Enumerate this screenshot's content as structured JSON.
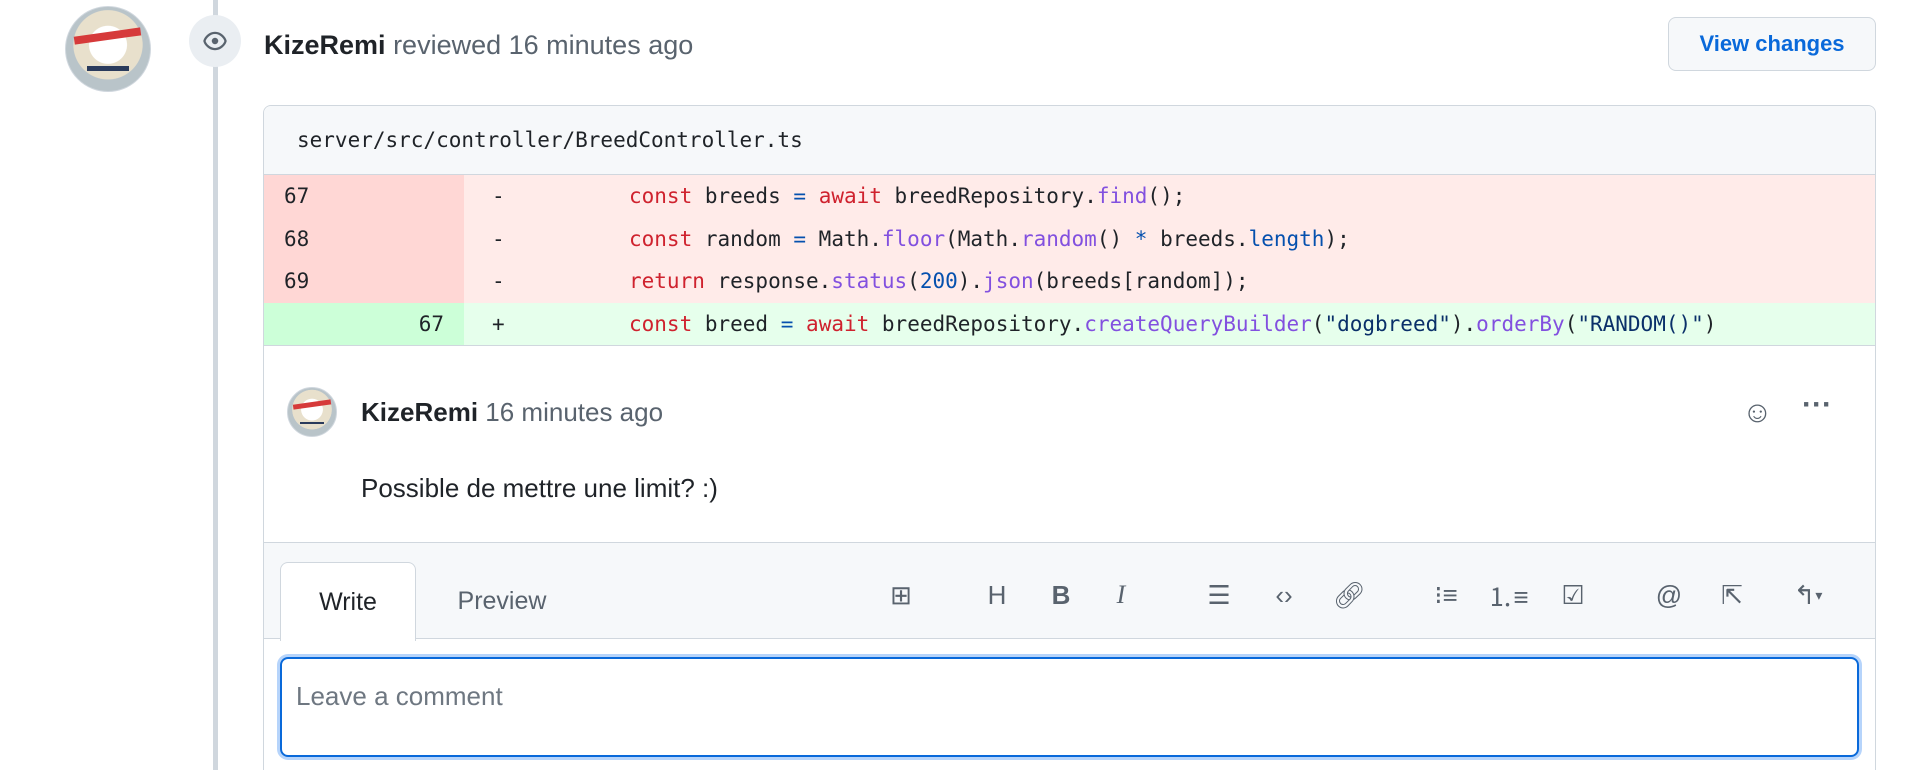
{
  "review": {
    "author": "KizeRemi",
    "action": "reviewed 16 minutes ago",
    "view_changes": "View changes"
  },
  "file": {
    "path": "server/src/controller/BreedController.ts"
  },
  "diff": [
    {
      "type": "del",
      "old": "67",
      "new": "",
      "sign": "-"
    },
    {
      "type": "del",
      "old": "68",
      "new": "",
      "sign": "-"
    },
    {
      "type": "del",
      "old": "69",
      "new": "",
      "sign": "-"
    },
    {
      "type": "add",
      "old": "",
      "new": "67",
      "sign": "+"
    }
  ],
  "code": {
    "l1": [
      "const",
      " breeds ",
      "=",
      " ",
      "await",
      " breedRepository.",
      "find",
      "();"
    ],
    "l2": [
      "const",
      " random ",
      "=",
      " Math.",
      "floor",
      "(Math.",
      "random",
      "() ",
      "*",
      " breeds.",
      "length",
      ");"
    ],
    "l3": [
      "return",
      " response.",
      "status",
      "(",
      "200",
      ").",
      "json",
      "(breeds[random]);"
    ],
    "l4": [
      "const",
      " breed ",
      "=",
      " ",
      "await",
      " breedRepository.",
      "createQueryBuilder",
      "(",
      "\"dogbreed\"",
      ").",
      "orderBy",
      "(",
      "\"RANDOM()\"",
      ")"
    ]
  },
  "comment": {
    "author": "KizeRemi",
    "time": "16 minutes ago",
    "body": "Possible de mettre une limit? :)"
  },
  "editor": {
    "tabs": [
      "Write",
      "Preview"
    ],
    "placeholder": "Leave a comment",
    "tools": [
      "insert-suggestion",
      "heading",
      "bold",
      "italic",
      "quote",
      "code",
      "link",
      "bulleted-list",
      "numbered-list",
      "task-list",
      "mention",
      "reference",
      "saved-replies"
    ]
  },
  "colors": {
    "accent": "#0969da",
    "deletion": "#ffebe9",
    "addition": "#e6ffec"
  }
}
